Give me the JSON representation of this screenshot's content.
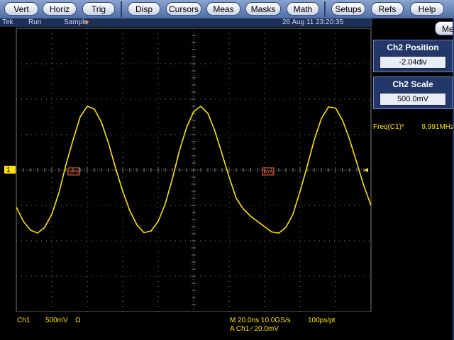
{
  "menu": {
    "items": [
      "Vert",
      "Horiz",
      "Trig",
      "Disp",
      "Cursors",
      "Meas",
      "Masks",
      "Math",
      "Setups",
      "Refs",
      "Help"
    ]
  },
  "status": {
    "brand": "Tek",
    "run_state": "Run",
    "acq_mode": "Sample",
    "datetime": "26 Aug 11 23:20:35"
  },
  "panel": {
    "menu_label": "Menu",
    "position_title": "Ch2 Position",
    "position_value": "-2.04div",
    "scale_title": "Ch2 Scale",
    "scale_value": "500.0mV",
    "freq_label": "Freq(C1)*",
    "freq_value": "9.991MHz"
  },
  "markers": {
    "channel": "1",
    "ref_pct": "50%"
  },
  "readout": {
    "channel": "Ch1",
    "volts_div": "500mV",
    "coupling": "Ω",
    "timebase": "M 20.0ns 10.0GS/s",
    "resolution": "100ps/pt",
    "trigger": "A  Ch1  ⁄  20.0mV"
  },
  "colors": {
    "trace": "#ffe100",
    "grid": "#7a7a7a",
    "menubar": "#5b78ae",
    "marker": "#ff6a3d"
  },
  "chart_data": {
    "type": "line",
    "x_divisions": 10,
    "y_divisions": 8,
    "series": [
      {
        "x": [
          0,
          0.2,
          0.4,
          0.6,
          0.8,
          1.0,
          1.2,
          1.4,
          1.6,
          1.8,
          2.0,
          2.2,
          2.4,
          2.6,
          2.8,
          3.0,
          3.2,
          3.4,
          3.6,
          3.8,
          4.0,
          4.2,
          4.4,
          4.6,
          4.8,
          5.0,
          5.2,
          5.4,
          5.6,
          5.8,
          6.0,
          6.2,
          6.4,
          6.6,
          6.8,
          7.0,
          7.2,
          7.4,
          7.6,
          7.8,
          8.0,
          8.2,
          8.4,
          8.6,
          8.8,
          9.0,
          9.2,
          9.4,
          9.6,
          9.8,
          10.0
        ],
        "y": [
          -1.05,
          -1.45,
          -1.7,
          -1.78,
          -1.62,
          -1.25,
          -0.65,
          0.15,
          0.85,
          1.5,
          1.8,
          1.72,
          1.35,
          0.75,
          0.05,
          -0.6,
          -1.15,
          -1.55,
          -1.77,
          -1.72,
          -1.45,
          -0.95,
          -0.25,
          0.55,
          1.2,
          1.65,
          1.8,
          1.6,
          1.1,
          0.45,
          -0.2,
          -0.8,
          -1.1,
          -1.3,
          -1.45,
          -1.6,
          -1.75,
          -1.78,
          -1.62,
          -1.25,
          -0.6,
          0.1,
          0.85,
          1.45,
          1.78,
          1.75,
          1.4,
          0.85,
          0.2,
          -0.45,
          -1.0
        ]
      }
    ]
  }
}
